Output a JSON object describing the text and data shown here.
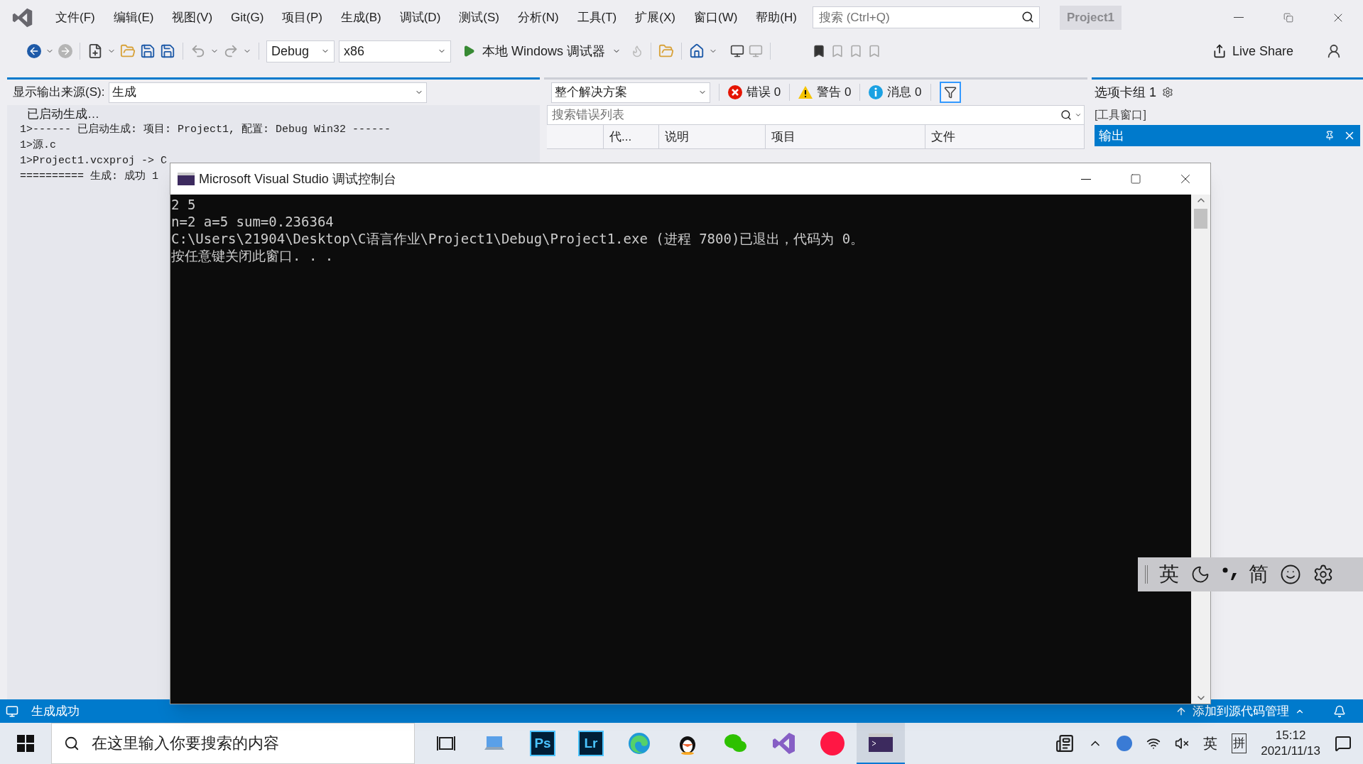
{
  "menu": [
    "文件(F)",
    "编辑(E)",
    "视图(V)",
    "Git(G)",
    "项目(P)",
    "生成(B)",
    "调试(D)",
    "测试(S)",
    "分析(N)",
    "工具(T)",
    "扩展(X)",
    "窗口(W)",
    "帮助(H)"
  ],
  "search": {
    "placeholder": "搜索 (Ctrl+Q)"
  },
  "project": "Project1",
  "toolbar": {
    "configuration": "Debug",
    "platform": "x86",
    "run": "本地 Windows 调试器",
    "live_share": "Live Share"
  },
  "output": {
    "label": "显示输出来源(S):",
    "source": "生成",
    "lines": [
      "已启动生成…",
      "1>------ 已启动生成: 项目: Project1, 配置: Debug Win32 ------",
      "1>源.c",
      "1>Project1.vcxproj -> C",
      "========== 生成: 成功 1"
    ]
  },
  "error_list": {
    "scope": "整个解决方案",
    "errors": "错误 0",
    "warnings": "警告 0",
    "messages": "消息 0",
    "filter_on": true,
    "search_placeholder": "搜索错误列表",
    "columns": [
      "代...",
      "说明",
      "项目",
      "文件"
    ]
  },
  "tab_group": {
    "title": "选项卡组 1",
    "section": "[工具窗口]",
    "items": [
      {
        "label": "输出",
        "selected": true
      }
    ]
  },
  "console": {
    "title": "Microsoft Visual Studio 调试控制台",
    "lines": [
      "2 5",
      "n=2 a=5 sum=0.236364",
      "C:\\Users\\21904\\Desktop\\C语言作业\\Project1\\Debug\\Project1.exe (进程 7800)已退出，代码为 0。",
      "按任意键关闭此窗口. . ."
    ]
  },
  "ime": {
    "mode": "英",
    "charset": "简"
  },
  "status_bar": {
    "message": "生成成功",
    "source_control": "添加到源代码管理"
  },
  "taskbar": {
    "search_placeholder": "在这里输入你要搜索的内容",
    "apps": [
      {
        "kind": "taskview"
      },
      {
        "kind": "computer"
      },
      {
        "kind": "tile",
        "label": "Ps"
      },
      {
        "kind": "tile",
        "label": "Lr"
      },
      {
        "kind": "edge"
      },
      {
        "kind": "penguin"
      },
      {
        "kind": "chat"
      },
      {
        "kind": "vs"
      },
      {
        "kind": "dot"
      },
      {
        "kind": "console"
      }
    ],
    "ime_mode": "英",
    "ime_layout": "拼",
    "time": "15:12",
    "date": "2021/11/13"
  }
}
